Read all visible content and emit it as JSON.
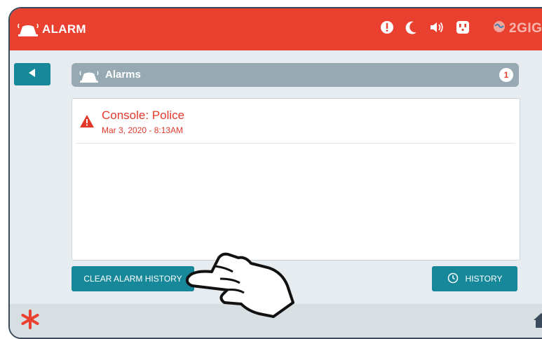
{
  "header": {
    "title": "ALARM",
    "brand": "2GIG",
    "status_icons": [
      "alert-icon",
      "moon-icon",
      "speaker-icon",
      "outlet-icon"
    ],
    "background_color": "#ea4030"
  },
  "alarms_bar": {
    "title": "Alarms",
    "count": "1"
  },
  "alarm_list": [
    {
      "name": "Console: Police",
      "time": "Mar 3, 2020 - 8:13AM"
    }
  ],
  "buttons": {
    "clear_history": "CLEAR ALARM HISTORY",
    "history": "HISTORY"
  },
  "accent_color": "#16889a",
  "alert_color": "#e2392b"
}
